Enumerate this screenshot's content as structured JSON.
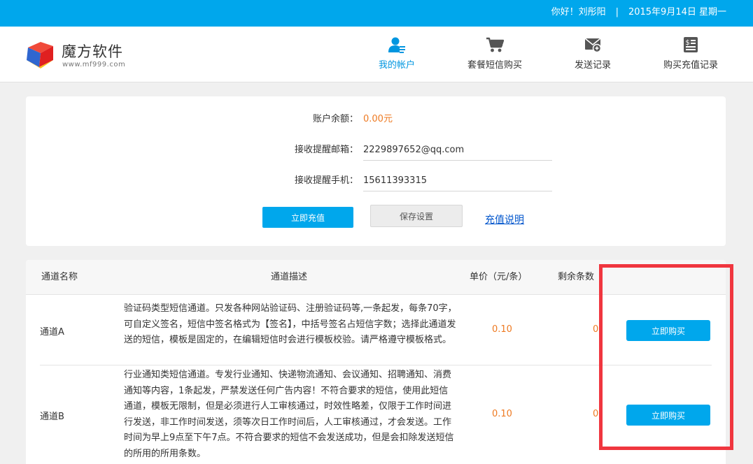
{
  "topbar": {
    "greeting": "你好！刘彤阳",
    "separator": "|",
    "date": "2015年9月14日 星期一"
  },
  "logo": {
    "name": "魔方软件",
    "url": "www.mf999.com"
  },
  "nav": {
    "items": [
      {
        "label": "我的帐户",
        "icon": "user-account-icon",
        "active": true
      },
      {
        "label": "套餐短信购买",
        "icon": "shopping-cart-icon",
        "active": false
      },
      {
        "label": "发送记录",
        "icon": "envelope-icon",
        "active": false
      },
      {
        "label": "购买充值记录",
        "icon": "dollar-receipt-icon",
        "active": false
      }
    ]
  },
  "account": {
    "balance_label": "账户余额：",
    "balance_value": "0.00元",
    "email_label": "接收提醒邮箱：",
    "email_value": "2229897652@qq.com",
    "phone_label": "接收提醒手机：",
    "phone_value": "15611393315",
    "recharge_button": "立即充值",
    "save_button": "保存设置",
    "help_link": "充值说明"
  },
  "table": {
    "headers": {
      "name": "通道名称",
      "desc": "通道描述",
      "price": "单价（元/条）",
      "remain": "剩余条数"
    },
    "rows": [
      {
        "name": "通道A",
        "desc": "验证码类型短信通道。只发各种网站验证码、注册验证码等,一条起发，每条70字，可自定义签名，短信中签名格式为【签名】，中括号签名占短信字数；选择此通道发送的短信，模板是固定的，在编辑短信时会进行模板校验。请严格遵守模板格式。",
        "price": "0.10",
        "remain": "0",
        "buy": "立即购买"
      },
      {
        "name": "通道B",
        "desc": "行业通知类短信通道。专发行业通知、快递物流通知、会议通知、招聘通知、消费通知等内容，1条起发，严禁发送任何广告内容！不符合要求的短信，使用此短信通道，模板无限制，但是必须进行人工审核通过，时效性略差，仅限于工作时间进行发送，非工作时间发送，须等次日工作时间后，人工审核通过，才会发送。工作时间为早上9点至下午7点。不符合要求的短信不会发送成功，但是会扣除发送短信的所用的所用条数。",
        "price": "0.10",
        "remain": "0",
        "buy": "立即购买"
      }
    ]
  },
  "colors": {
    "accent": "#00a7ec",
    "orange": "#ee7a22",
    "highlight": "#f0363f"
  }
}
